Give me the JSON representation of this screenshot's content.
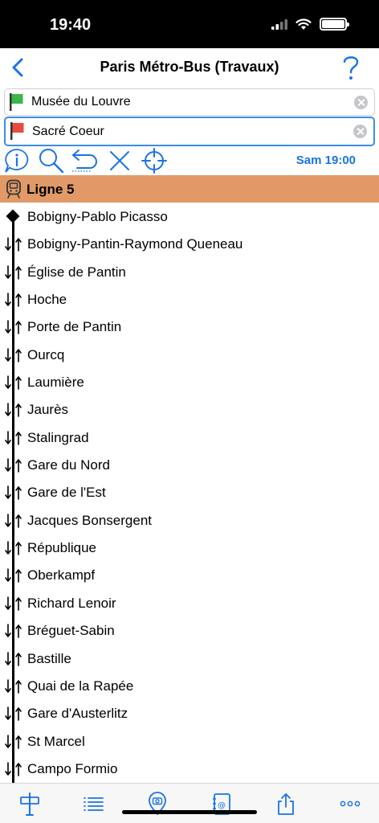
{
  "status_bar": {
    "time": "19:40"
  },
  "nav": {
    "title": "Paris Métro-Bus (Travaux)"
  },
  "origin": {
    "value": "Musée du Louvre",
    "flag_color": "#3cb54a"
  },
  "destination": {
    "value": "Sacré Coeur",
    "flag_color": "#ea4a3c"
  },
  "toolbar": {
    "tools": [
      "info-icon",
      "search-icon",
      "undo-icon",
      "close-icon",
      "locate-icon"
    ],
    "datetime": "Sam 19:00"
  },
  "line": {
    "label": "Ligne 5",
    "color": "#e19a67"
  },
  "stations": [
    "Bobigny-Pablo Picasso",
    "Bobigny-Pantin-Raymond Queneau",
    "Église de Pantin",
    "Hoche",
    "Porte de Pantin",
    "Ourcq",
    "Laumière",
    "Jaurès",
    "Stalingrad",
    "Gare du Nord",
    "Gare de l'Est",
    "Jacques Bonsergent",
    "République",
    "Oberkampf",
    "Richard Lenoir",
    "Bréguet-Sabin",
    "Bastille",
    "Quai de la Rapée",
    "Gare d'Austerlitz",
    "St Marcel",
    "Campo Formio"
  ],
  "tabbar": {
    "tabs": [
      "signpost-icon",
      "list-icon",
      "map-pin-icon",
      "contacts-icon",
      "share-icon",
      "more-icon"
    ]
  },
  "accent": "#1a73e8"
}
